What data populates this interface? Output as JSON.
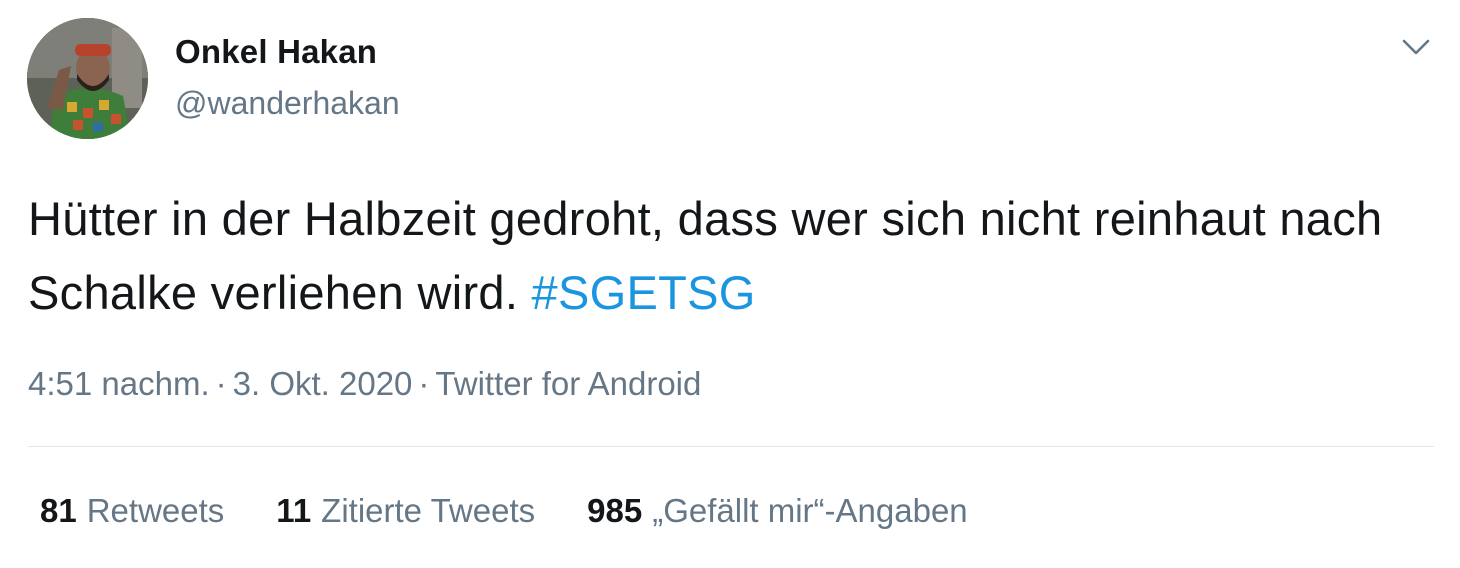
{
  "user": {
    "display_name": "Onkel Hakan",
    "handle": "@wanderhakan"
  },
  "tweet": {
    "text": "Hütter in der Halbzeit gedroht, dass wer sich nicht reinhaut nach Schalke verliehen wird.",
    "hashtag": "#SGETSG",
    "time": "4:51 nachm.",
    "date": "3. Okt. 2020",
    "separator": "·",
    "source": "Twitter for Android"
  },
  "stats": {
    "retweets_count": "81",
    "retweets_label": "Retweets",
    "quotes_count": "11",
    "quotes_label": "Zitierte Tweets",
    "likes_count": "985",
    "likes_label": "„Gefällt mir“-Angaben"
  },
  "colors": {
    "hashtag": "#1b95e0",
    "secondary_text": "#657786",
    "primary_text": "#14171a",
    "divider": "#e1e8ed"
  },
  "icons": {
    "more_menu": "chevron-down-icon"
  }
}
